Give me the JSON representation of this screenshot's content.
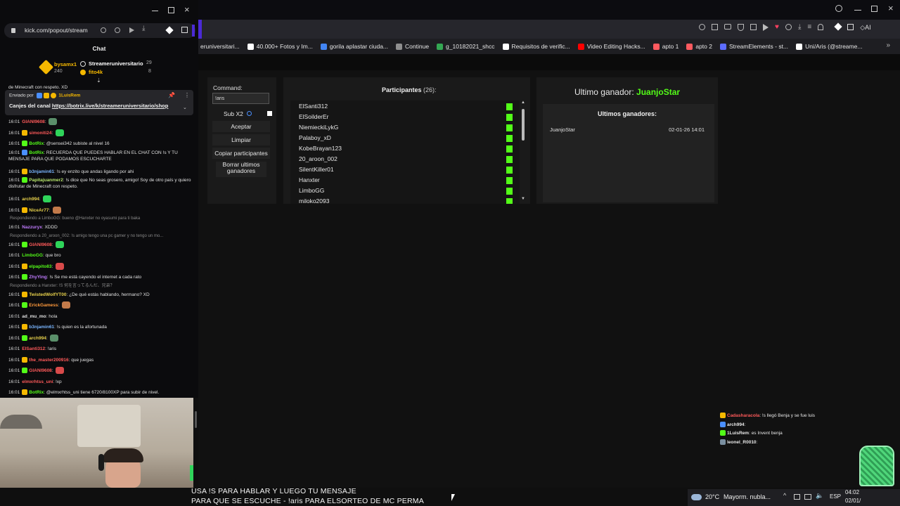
{
  "popout": {
    "url": "kick.com/popout/stream",
    "chat_title": "Chat",
    "leaders": [
      {
        "name": "bysamx1",
        "points": "240",
        "color": "#f5b800"
      },
      {
        "name": "Streameruniversitario",
        "points": "29",
        "color": "#ffffff"
      },
      {
        "name": "fito4k",
        "points": "8",
        "color": "#f5b800"
      }
    ],
    "cut_line": "de Minecraft con respeto. XD",
    "pinned": {
      "sent_by_label": "Enviado por",
      "sent_by_user": "1LuisRem",
      "text": "Canjes del canal",
      "link": "https://botrix.live/k/streameruniversitario/shop"
    },
    "messages": [
      {
        "time": "16:01",
        "user": "GIANI9608",
        "color": "#ff5a5a",
        "text": ""
      },
      {
        "time": "16:01",
        "user": "simoniti24",
        "color": "#ff5a5a",
        "text": ""
      },
      {
        "time": "16:01",
        "user": "BotRix",
        "color": "#53fc18",
        "text": "@sensei342 subiste al nivel 16"
      },
      {
        "time": "16:01",
        "user": "BotRix",
        "color": "#53fc18",
        "text": "RECUERDA QUE PUEDES HABLAR EN EL CHAT CON !s Y TU MENSAJE PARA QUE PODAMOS ESCUCHARTE"
      },
      {
        "time": "16:01",
        "user": "b3njamin61",
        "color": "#7ab6ff",
        "text": "!s ey enzito que andas ligando por ahi"
      },
      {
        "time": "16:01",
        "user": "Papitajuanmer2",
        "color": "#b5e36b",
        "text": "!s dice que No seas grosero, amigo! Soy de otro país y quiero disfrutar de Minecraft con respeto."
      },
      {
        "time": "16:01",
        "user": "arch994",
        "color": "#e7d14c",
        "text": ""
      },
      {
        "time": "16:01",
        "user": "NiceAr77",
        "color": "#e7d14c",
        "text": ""
      },
      {
        "reply": "Respondiendo a LimboGG: bueno @Hanxter no oyasumi para ti baka"
      },
      {
        "time": "16:01",
        "user": "Nazzuryx",
        "color": "#c17cff",
        "text": "XDDD"
      },
      {
        "reply": "Respondiendo a 20_aroon_002: !s amigo tengo una pc gamer y no tengo un mo..."
      },
      {
        "time": "16:01",
        "user": "GIANI9608",
        "color": "#ff5a5a",
        "text": ""
      },
      {
        "time": "16:01",
        "user": "LimboGG",
        "color": "#53fc18",
        "text": "que bro"
      },
      {
        "time": "16:01",
        "user": "elpapito83",
        "color": "#53fc18",
        "text": ""
      },
      {
        "time": "16:01",
        "user": "ZhyYing",
        "color": "#c17cff",
        "text": "!s Se me está cayendo el internet a cada rato"
      },
      {
        "reply": "Respondiendo a Hanxter: !S 何を言ってるんだ、兄弟？"
      },
      {
        "time": "16:01",
        "user": "TwistedWolfYT00",
        "color": "#e7d14c",
        "text": "¿De qué estás hablando, hermano? XD"
      },
      {
        "time": "16:01",
        "user": "ErickGamess",
        "color": "#ff9a3c",
        "text": ""
      },
      {
        "time": "16:01",
        "user": "ad_mu_mo",
        "color": "#e0e0e0",
        "text": "hola"
      },
      {
        "time": "16:01",
        "user": "b3njamin61",
        "color": "#7ab6ff",
        "text": "!s quien es la afortunada"
      },
      {
        "time": "16:01",
        "user": "arch994",
        "color": "#e7d14c",
        "text": ""
      },
      {
        "time": "16:01",
        "user": "ElSanti312",
        "color": "#ff5a5a",
        "text": "!aris"
      },
      {
        "time": "16:01",
        "user": "the_master200916",
        "color": "#ff5a5a",
        "text": "que juegas"
      },
      {
        "time": "16:01",
        "user": "GIANI9608",
        "color": "#ff5a5a",
        "text": ""
      },
      {
        "time": "16:01",
        "user": "elmxrhtss_uni",
        "color": "#ff5a5a",
        "text": "!xp"
      },
      {
        "time": "16:01",
        "user": "BotRix",
        "color": "#53fc18",
        "text": "@elmxrhtss_uni tiene 6720/8100XP para subir de nivel."
      }
    ]
  },
  "bookmarks": [
    {
      "label": "eruniversitari...",
      "color": "#6b6b6b"
    },
    {
      "label": "40.000+ Fotos y Im...",
      "color": "#ffffff"
    },
    {
      "label": "gorila aplastar ciuda...",
      "color": "#4285f4"
    },
    {
      "label": "Continue",
      "color": "#8f8f8f"
    },
    {
      "label": "g_10182021_shcc",
      "color": "#34a853"
    },
    {
      "label": "Requisitos de verific...",
      "color": "#ffffff"
    },
    {
      "label": "Video Editing Hacks...",
      "color": "#ff0000"
    },
    {
      "label": "apto 1",
      "color": "#ff5a5f"
    },
    {
      "label": "apto 2",
      "color": "#ff5a5f"
    },
    {
      "label": "StreamElements - st...",
      "color": "#5c6cff"
    },
    {
      "label": "Uni/Aris (@streame...",
      "color": "#ffffff"
    }
  ],
  "giveaway": {
    "command_label": "Command:",
    "command_value": "!aris",
    "sub_label": "Sub X2",
    "buttons": [
      "Aceptar",
      "Limpiar",
      "Copiar participantes",
      "Borrar ultimos ganadores"
    ],
    "participants_label": "Participantes",
    "participants_count": "(26):",
    "participants": [
      "ElSanti312",
      "ElSoilderEr",
      "NiemieckiLykG",
      "Palaboy_xD",
      "KobeBrayan123",
      "20_aroon_002",
      "SilentKiller01",
      "Hanxter",
      "LimboGG",
      "miloko2093"
    ],
    "last_winner_label": "Ultimo ganador:",
    "last_winner": "JuanjoStar",
    "winners_title": "Ultimos ganadores:",
    "winners": [
      {
        "name": "JuanjoStar",
        "date": "02-01-26 14:01"
      }
    ]
  },
  "mini_chat": [
    {
      "user": "Cadasharacola",
      "color": "#ff5a5a",
      "text": ": !s llegó Benja y se fue luis"
    },
    {
      "user": "arch994",
      "color": "#e8e8e8",
      "text": ":"
    },
    {
      "user": "1LuisRem",
      "color": "#e8e8e8",
      "text": ": es Invent benja"
    },
    {
      "user": "leonel_R0010",
      "color": "#e8e8e8",
      "text": ":"
    }
  ],
  "overlay_text": {
    "line1": "USA !S PARA HABLAR Y LUEGO TU MENSAJE",
    "line2": "PARA QUE SE ESCUCHE - !aris PARA ELSORTEO DE MC PERMA"
  },
  "taskbar": {
    "weather": "20°C",
    "weather_desc": "Mayorm. nubla...",
    "lang": "ESP",
    "time": "04:02",
    "date": "02/01/"
  },
  "colors": {
    "kick_green": "#53fc18",
    "accent_purple": "#4b2ad6"
  }
}
